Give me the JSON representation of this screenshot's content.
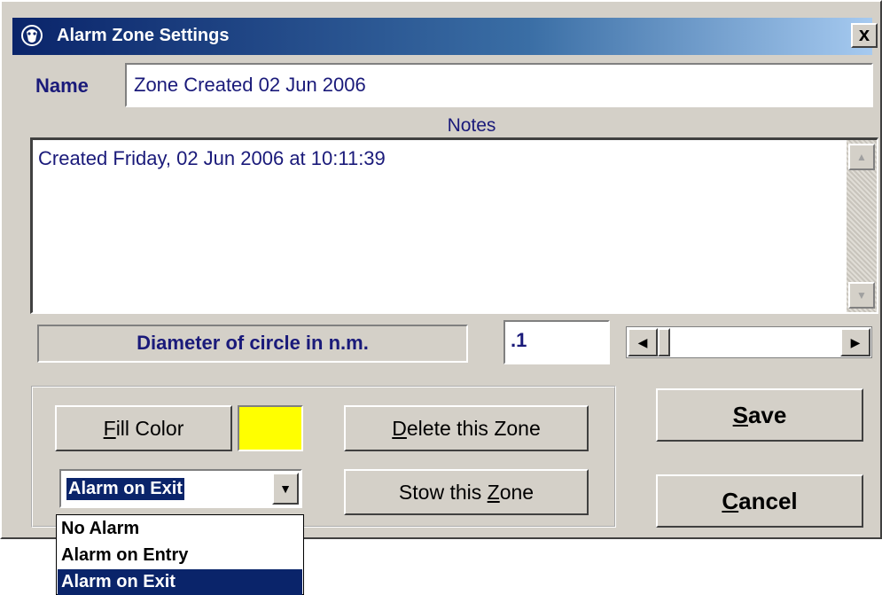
{
  "window": {
    "title": "Alarm Zone Settings",
    "close_label": "x"
  },
  "name": {
    "label": "Name",
    "value": "Zone Created 02 Jun 2006"
  },
  "notes": {
    "label": "Notes",
    "text": "Created Friday, 02 Jun 2006 at 10:11:39"
  },
  "diameter": {
    "label": "Diameter of circle in n.m.",
    "value": ".1"
  },
  "buttons": {
    "fill_color_u": "F",
    "fill_color_rest": "ill Color",
    "delete_u": "D",
    "delete_rest": "elete this Zone",
    "stow_pre": "Stow this ",
    "stow_u": "Z",
    "stow_rest": "one",
    "save_u": "S",
    "save_rest": "ave",
    "cancel_u": "C",
    "cancel_rest": "ancel"
  },
  "fill_color": "#ffff00",
  "alarm": {
    "selected": "Alarm on Exit",
    "options": [
      "No Alarm",
      "Alarm on Entry",
      "Alarm on Exit"
    ],
    "selected_index": 2
  },
  "colors": {
    "accent": "#0a246a",
    "text": "#1a1a7a",
    "face": "#d4d0c8"
  },
  "icons": {
    "title": "shield-icon",
    "scroll_up": "arrow-up-icon",
    "scroll_down": "arrow-down-icon"
  }
}
